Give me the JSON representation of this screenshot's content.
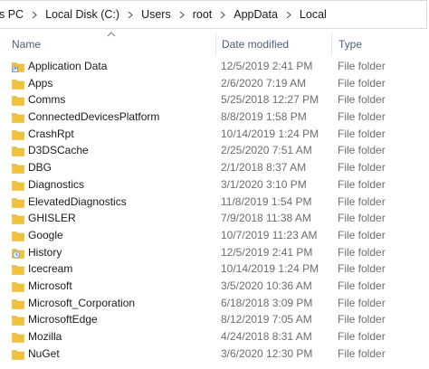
{
  "address": {
    "crumbs": [
      "s PC",
      "Local Disk (C:)",
      "Users",
      "root",
      "AppData",
      "Local"
    ]
  },
  "columns": {
    "name": "Name",
    "date": "Date modified",
    "type": "Type"
  },
  "colors": {
    "folder": "#f0c23b",
    "folder_dark": "#dca72a",
    "header_text": "#4c607a",
    "secondary_text": "#6d6d6d"
  },
  "rows": [
    {
      "name": "Application Data",
      "date": "12/5/2019 2:41 PM",
      "type": "File folder",
      "icon": "folder-shortcut-icon"
    },
    {
      "name": "Apps",
      "date": "2/6/2020 7:19 AM",
      "type": "File folder",
      "icon": "folder-icon"
    },
    {
      "name": "Comms",
      "date": "5/25/2018 12:27 PM",
      "type": "File folder",
      "icon": "folder-icon"
    },
    {
      "name": "ConnectedDevicesPlatform",
      "date": "8/8/2019 1:58 PM",
      "type": "File folder",
      "icon": "folder-icon"
    },
    {
      "name": "CrashRpt",
      "date": "10/14/2019 1:24 PM",
      "type": "File folder",
      "icon": "folder-icon"
    },
    {
      "name": "D3DSCache",
      "date": "2/25/2020 7:51 AM",
      "type": "File folder",
      "icon": "folder-icon"
    },
    {
      "name": "DBG",
      "date": "2/1/2018 8:37 AM",
      "type": "File folder",
      "icon": "folder-icon"
    },
    {
      "name": "Diagnostics",
      "date": "3/1/2020 3:10 PM",
      "type": "File folder",
      "icon": "folder-icon"
    },
    {
      "name": "ElevatedDiagnostics",
      "date": "11/8/2019 1:54 PM",
      "type": "File folder",
      "icon": "folder-icon"
    },
    {
      "name": "GHISLER",
      "date": "7/9/2018 11:38 AM",
      "type": "File folder",
      "icon": "folder-icon"
    },
    {
      "name": "Google",
      "date": "10/7/2019 11:23 AM",
      "type": "File folder",
      "icon": "folder-icon"
    },
    {
      "name": "History",
      "date": "12/5/2019 2:41 PM",
      "type": "File folder",
      "icon": "history-folder-icon"
    },
    {
      "name": "Icecream",
      "date": "10/14/2019 1:24 PM",
      "type": "File folder",
      "icon": "folder-icon"
    },
    {
      "name": "Microsoft",
      "date": "3/5/2020 10:36 AM",
      "type": "File folder",
      "icon": "folder-icon"
    },
    {
      "name": "Microsoft_Corporation",
      "date": "6/18/2018 3:09 PM",
      "type": "File folder",
      "icon": "folder-icon"
    },
    {
      "name": "MicrosoftEdge",
      "date": "8/12/2019 7:05 AM",
      "type": "File folder",
      "icon": "folder-icon"
    },
    {
      "name": "Mozilla",
      "date": "4/24/2018 8:31 AM",
      "type": "File folder",
      "icon": "folder-icon"
    },
    {
      "name": "NuGet",
      "date": "3/6/2020 12:30 PM",
      "type": "File folder",
      "icon": "folder-icon"
    }
  ]
}
